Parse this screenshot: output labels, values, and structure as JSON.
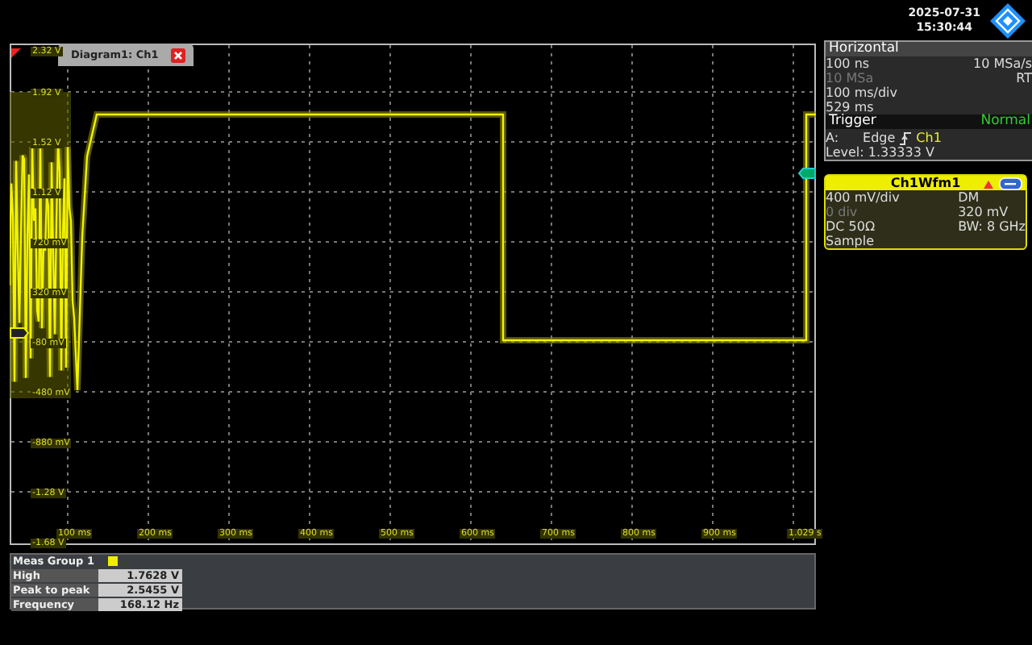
{
  "header": {
    "date": "2025-07-31",
    "time": "15:30:44"
  },
  "diagram": {
    "tab_title": "Diagram1: Ch1",
    "y_labels": [
      "2.32 V",
      "1.92 V",
      "1.52 V",
      "1.12 V",
      "720 mV",
      "320 mV",
      "-80 mV",
      "-480 mV",
      "-880 mV",
      "-1.28 V",
      "-1.68 V"
    ],
    "x_labels": [
      "100 ms",
      "200 ms",
      "300 ms",
      "400 ms",
      "500 ms",
      "600 ms",
      "700 ms",
      "800 ms",
      "900 ms",
      "1.029 s"
    ]
  },
  "measurements": {
    "title": "Meas Group 1",
    "rows": [
      {
        "label": "High",
        "value": "1.7628 V"
      },
      {
        "label": "Peak to peak",
        "value": "2.5455 V"
      },
      {
        "label": "Frequency",
        "value": "168.12 Hz"
      }
    ]
  },
  "horizontal": {
    "title": "Horizontal",
    "left": [
      {
        "text": "100 ns",
        "dimmed": false
      },
      {
        "text": "10 MSa",
        "dimmed": true
      },
      {
        "text": "100 ms/div",
        "dimmed": false
      },
      {
        "text": "529 ms",
        "dimmed": false
      }
    ],
    "right": [
      "10 MSa/s",
      "RT"
    ]
  },
  "trigger": {
    "title": "Trigger",
    "mode": "Normal",
    "source": "A:",
    "type": "Edge",
    "channel": "Ch1",
    "level": "Level: 1.33333 V"
  },
  "channel": {
    "title": "Ch1Wfm1",
    "left": [
      {
        "text": "400 mV/div",
        "dimmed": false
      },
      {
        "text": "0 div",
        "dimmed": true
      },
      {
        "text": "DC 50Ω",
        "dimmed": false
      },
      {
        "text": "Sample",
        "dimmed": false
      }
    ],
    "right": [
      "DM",
      "320 mV",
      "BW: 8 GHz"
    ]
  }
}
